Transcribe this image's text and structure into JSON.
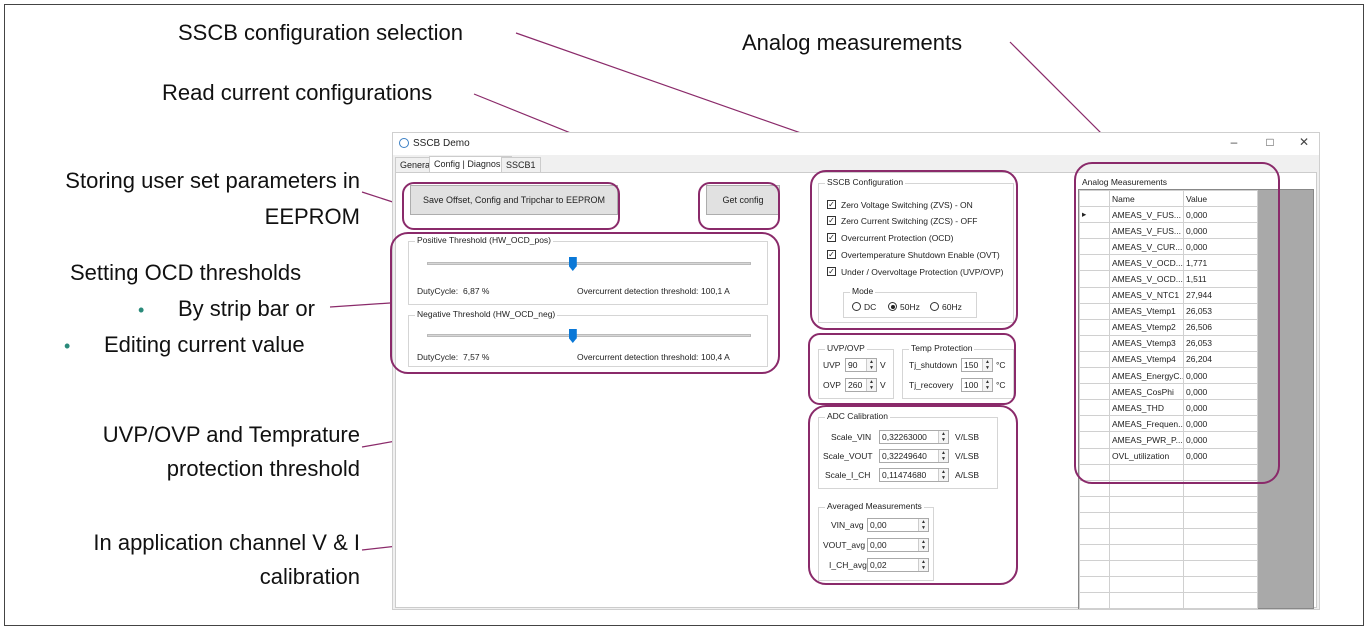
{
  "callouts": {
    "sscb_selection": "SSCB configuration selection",
    "analog": "Analog measurements",
    "read_config": "Read current configurations",
    "eeprom_line1": "Storing user set parameters in",
    "eeprom_line2": "EEPROM",
    "ocd_title": "Setting OCD thresholds",
    "ocd_bullet1": "By strip bar or",
    "ocd_bullet2": "Editing current value",
    "uvp_line1": "UVP/OVP and Temprature",
    "uvp_line2": "protection threshold",
    "calib_line1": "In application channel V & I",
    "calib_line2": "calibration"
  },
  "window": {
    "title": "SSCB Demo",
    "min": "–",
    "max": "□",
    "close": "✕",
    "tabs": [
      "General",
      "Config | Diagnosis",
      "SSCB1"
    ]
  },
  "buttons": {
    "save_eeprom": "Save Offset, Config and Tripchar to EEPROM",
    "get_config": "Get config"
  },
  "ocd_pos": {
    "caption": "Positive Threshold (HW_OCD_pos)",
    "duty_label": "DutyCycle:",
    "duty_value": "6,87 %",
    "thr_label": "Overcurrent detection threshold:",
    "thr_value": "100,1 A",
    "slider_fraction": 0.45
  },
  "ocd_neg": {
    "caption": "Negative Threshold (HW_OCD_neg)",
    "duty_label": "DutyCycle:",
    "duty_value": "7,57 %",
    "thr_label": "Overcurrent detection threshold:",
    "thr_value": "100,4 A",
    "slider_fraction": 0.45
  },
  "sscb_config": {
    "caption": "SSCB Configuration",
    "items": [
      "Zero Voltage Switching (ZVS) - ON",
      "Zero Current Switching (ZCS) - OFF",
      "Overcurrent Protection (OCD)",
      "Overtemperature Shutdown Enable (OVT)",
      "Under / Overvoltage Protection (UVP/OVP)"
    ],
    "mode_caption": "Mode",
    "modes": [
      "DC",
      "50Hz",
      "60Hz"
    ],
    "selected_mode": "50Hz"
  },
  "uvp_ovp": {
    "caption": "UVP/OVP",
    "uvp_label": "UVP",
    "uvp_value": "90",
    "uvp_unit": "V",
    "ovp_label": "OVP",
    "ovp_value": "260",
    "ovp_unit": "V"
  },
  "temp": {
    "caption": "Temp Protection",
    "shutdown_label": "Tj_shutdown",
    "shutdown_value": "150",
    "shutdown_unit": "°C",
    "recovery_label": "Tj_recovery",
    "recovery_value": "100",
    "recovery_unit": "°C"
  },
  "adc": {
    "caption": "ADC Calibration",
    "rows": [
      {
        "label": "Scale_VIN",
        "value": "0,32263000",
        "unit": "V/LSB"
      },
      {
        "label": "Scale_VOUT",
        "value": "0,32249640",
        "unit": "V/LSB"
      },
      {
        "label": "Scale_I_CH",
        "value": "0,11474680",
        "unit": "A/LSB"
      }
    ]
  },
  "averaged": {
    "caption": "Averaged Measurements",
    "rows": [
      {
        "label": "VIN_avg",
        "value": "0,00"
      },
      {
        "label": "VOUT_avg",
        "value": "0,00"
      },
      {
        "label": "I_CH_avg",
        "value": "0,02"
      }
    ]
  },
  "analog": {
    "caption": "Analog Measurements",
    "col_name": "Name",
    "col_value": "Value",
    "rows": [
      {
        "name": "AMEAS_V_FUS...",
        "value": "0,000"
      },
      {
        "name": "AMEAS_V_FUS...",
        "value": "0,000"
      },
      {
        "name": "AMEAS_V_CUR...",
        "value": "0,000"
      },
      {
        "name": "AMEAS_V_OCD...",
        "value": "1,771"
      },
      {
        "name": "AMEAS_V_OCD...",
        "value": "1,511"
      },
      {
        "name": "AMEAS_V_NTC1",
        "value": "27,944"
      },
      {
        "name": "AMEAS_Vtemp1",
        "value": "26,053"
      },
      {
        "name": "AMEAS_Vtemp2",
        "value": "26,506"
      },
      {
        "name": "AMEAS_Vtemp3",
        "value": "26,053"
      },
      {
        "name": "AMEAS_Vtemp4",
        "value": "26,204"
      },
      {
        "name": "AMEAS_EnergyC...",
        "value": "0,000"
      },
      {
        "name": "AMEAS_CosPhi",
        "value": "0,000"
      },
      {
        "name": "AMEAS_THD",
        "value": "0,000"
      },
      {
        "name": "AMEAS_Frequen...",
        "value": "0,000"
      },
      {
        "name": "AMEAS_PWR_P...",
        "value": "0,000"
      },
      {
        "name": "OVL_utilization",
        "value": "0,000"
      }
    ]
  },
  "colors": {
    "highlight": "#8a2a6a",
    "bullet": "#2a8a7a",
    "slider_thumb": "#0a78d7"
  }
}
